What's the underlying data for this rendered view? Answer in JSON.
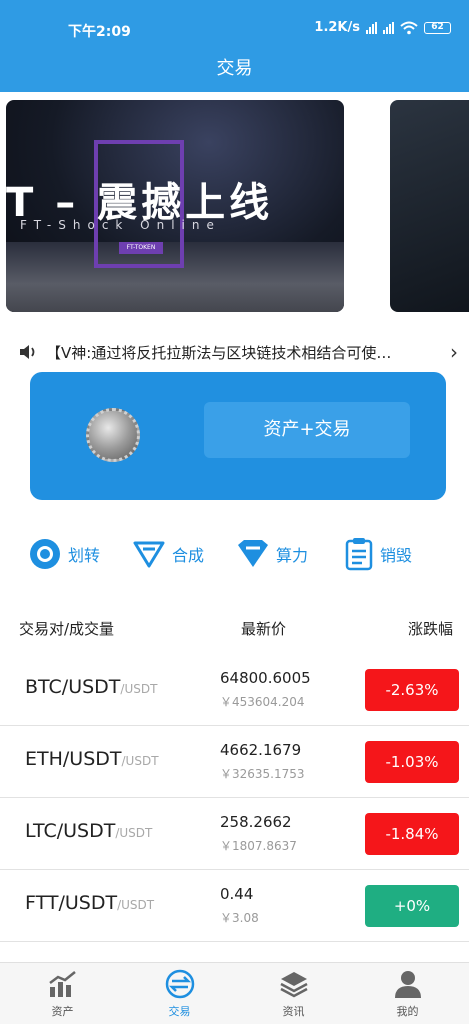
{
  "status": {
    "time": "下午2:09",
    "speed": "1.2K/s",
    "battery": "62"
  },
  "header": {
    "title": "交易"
  },
  "banner": {
    "title": "T – 震撼上线",
    "subtitle": "FT-Shock Online",
    "tag": "FT-TOKEN"
  },
  "notice": {
    "text": "【V神:通过将反托拉斯法与区块链技术相结合可使…"
  },
  "asset": {
    "button_label": "资产+交易"
  },
  "shortcuts": [
    {
      "label": "划转",
      "icon": "transfer-icon"
    },
    {
      "label": "合成",
      "icon": "synthesize-icon"
    },
    {
      "label": "算力",
      "icon": "hashpower-icon"
    },
    {
      "label": "销毁",
      "icon": "burn-icon"
    }
  ],
  "list": {
    "headers": {
      "pair": "交易对/成交量",
      "price": "最新价",
      "change": "涨跌幅"
    },
    "rows": [
      {
        "base": "BTC/USDT",
        "quote": "/USDT",
        "price": "64800.6005",
        "cny": "￥453604.204",
        "change": "-2.63%",
        "color": "#f5161a"
      },
      {
        "base": "ETH/USDT",
        "quote": "/USDT",
        "price": "4662.1679",
        "cny": "￥32635.1753",
        "change": "-1.03%",
        "color": "#f5161a"
      },
      {
        "base": "LTC/USDT",
        "quote": "/USDT",
        "price": "258.2662",
        "cny": "￥1807.8637",
        "change": "-1.84%",
        "color": "#f5161a"
      },
      {
        "base": "FTT/USDT",
        "quote": "/USDT",
        "price": "0.44",
        "cny": "￥3.08",
        "change": "+0%",
        "color": "#1fae82"
      }
    ]
  },
  "tabbar": [
    {
      "label": "资产",
      "icon": "assets-chart-icon",
      "active": false
    },
    {
      "label": "交易",
      "icon": "trade-icon",
      "active": true
    },
    {
      "label": "资讯",
      "icon": "news-layers-icon",
      "active": false
    },
    {
      "label": "我的",
      "icon": "profile-icon",
      "active": false
    }
  ],
  "colors": {
    "primary": "#2f9be4",
    "card": "#2190e0",
    "down": "#f5161a",
    "up": "#1fae82"
  }
}
